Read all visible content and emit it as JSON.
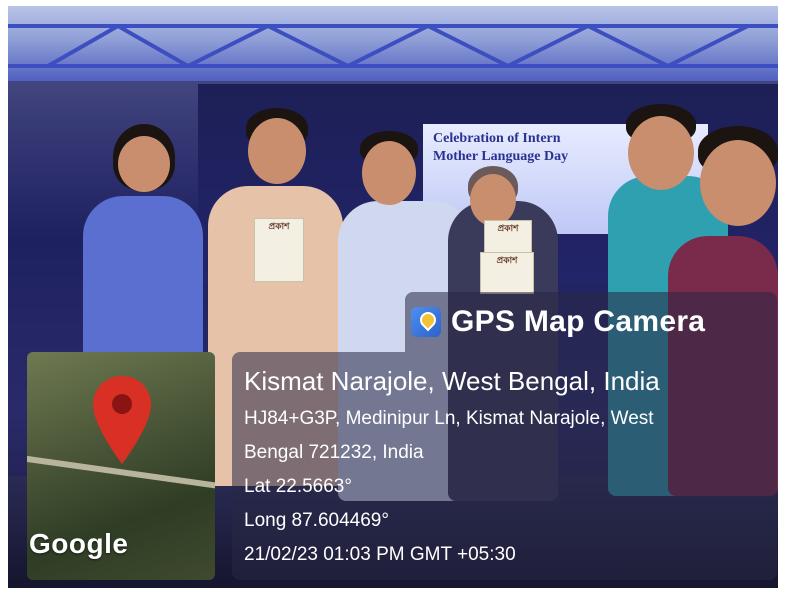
{
  "banner": {
    "line1": "Celebration of Intern",
    "line2": "Mother Language Day"
  },
  "booklets": [
    "প্রকাশ",
    "প্রকাশ",
    "প্রকাশ"
  ],
  "gps": {
    "app_name": "GPS Map Camera",
    "place": "Kismat Narajole, West Bengal, India",
    "address_line1": "HJ84+G3P, Medinipur Ln, Kismat Narajole, West",
    "address_line2": "Bengal 721232, India",
    "lat": "Lat 22.5663°",
    "long": "Long 87.604469°",
    "datetime": "21/02/23 01:03 PM GMT +05:30"
  },
  "map": {
    "logo": "Google",
    "pin_icon": "map-pin-icon",
    "pin_color": "#d93025"
  },
  "colors": {
    "overlay": "#282846",
    "stage_light": "#5160c0"
  }
}
